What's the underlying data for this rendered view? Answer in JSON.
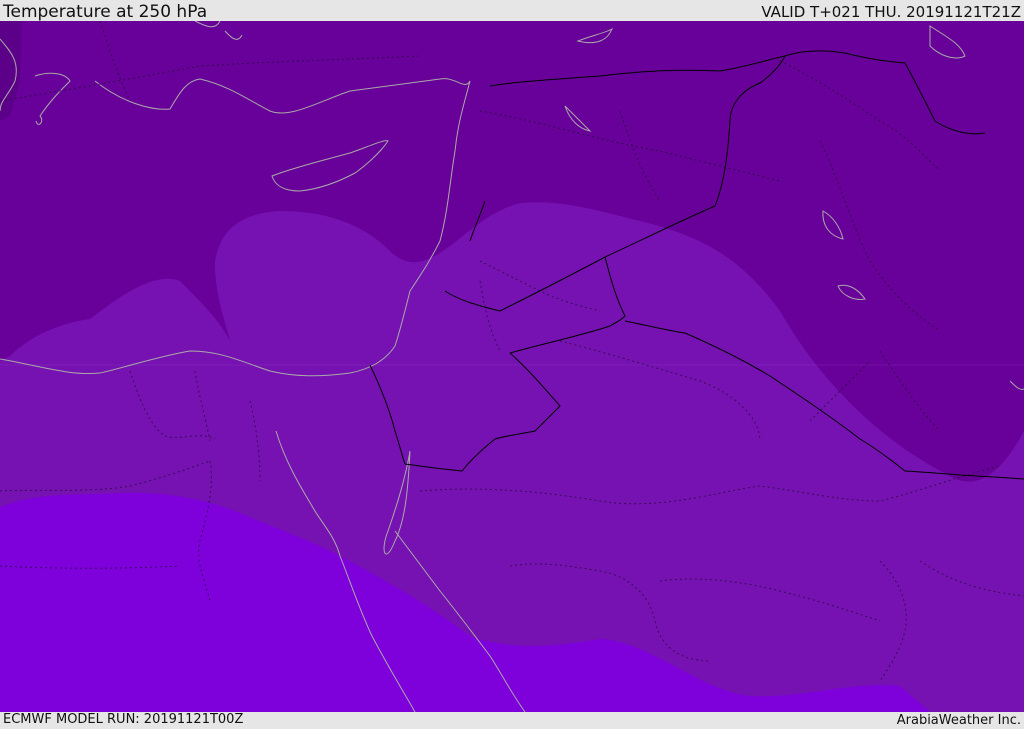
{
  "header": {
    "title": "Temperature at 250 hPa",
    "valid": "VALID T+021 THU. 20191121T21Z"
  },
  "footer": {
    "model_run": "ECMWF MODEL RUN: 20191121T00Z",
    "credit": "ArabiaWeather Inc."
  },
  "colors": {
    "coldest": "#5e008c",
    "cold": "#670199",
    "mid": "#7611b0",
    "warm": "#7e00dc",
    "coast": "#a0a0a0",
    "border": "#000000"
  }
}
